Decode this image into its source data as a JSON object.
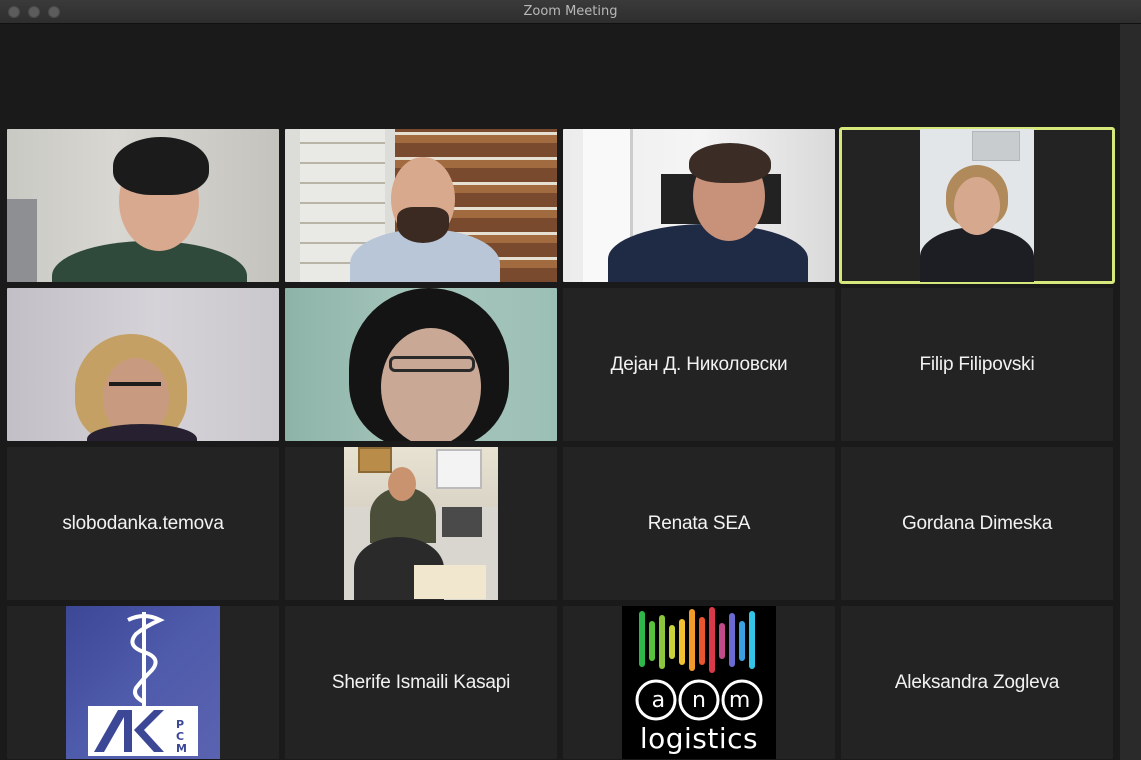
{
  "window": {
    "title": "Zoom Meeting"
  },
  "participants": {
    "p1": {
      "name": "",
      "type": "video"
    },
    "p2": {
      "name": "",
      "type": "video"
    },
    "p3": {
      "name": "",
      "type": "video"
    },
    "p4": {
      "name": "",
      "type": "video",
      "active_speaker": true
    },
    "p5": {
      "name": "",
      "type": "video"
    },
    "p6": {
      "name": "",
      "type": "video"
    },
    "p7": {
      "name": "Дејан Д. Николовски",
      "type": "name"
    },
    "p8": {
      "name": "Filip Filipovski",
      "type": "name"
    },
    "p9": {
      "name": "slobodanka.temova",
      "type": "name"
    },
    "p10": {
      "name": "",
      "type": "photo"
    },
    "p11": {
      "name": "Renata SEA",
      "type": "name"
    },
    "p12": {
      "name": "Gordana Dimeska",
      "type": "name"
    },
    "p13": {
      "name": "",
      "type": "logo",
      "logo_text": "ЛКРСМ"
    },
    "p14": {
      "name": "Sherife Ismaili Kasapi",
      "type": "name"
    },
    "p15": {
      "name": "",
      "type": "logo",
      "logo_text": "anm logistics"
    },
    "p16": {
      "name": "Aleksandra Zogleva",
      "type": "name"
    }
  },
  "colors": {
    "active_border": "#d6e77c",
    "tile_bg": "#232323",
    "stage_bg": "#1a1a1a"
  }
}
